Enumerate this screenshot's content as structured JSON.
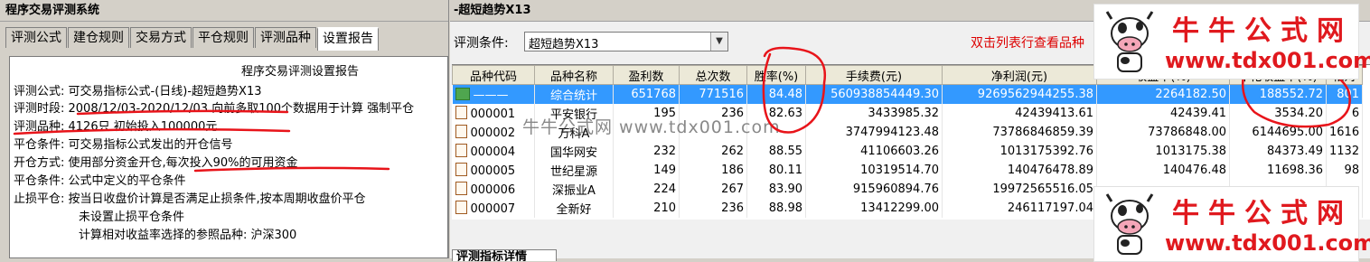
{
  "left_panel": {
    "title": "程序交易评测系统",
    "tabs": [
      "评测公式",
      "建仓规则",
      "交易方式",
      "平仓规则",
      "评测品种",
      "设置报告"
    ],
    "active_tab": "设置报告",
    "report": {
      "title": "程序交易评测设置报告",
      "lines": [
        "评测公式: 可交易指标公式-(日线)-超短趋势X13",
        "评测时段: 2008/12/03-2020/12/03 向前多取100个数据用于计算 强制平仓",
        "评测品种: 4126只 初始投入100000元",
        "平仓条件: 可交易指标公式发出的开仓信号",
        "开仓方式: 使用部分资金开仓,每次投入90%的可用资金",
        "平仓条件: 公式中定义的平仓条件",
        "止损平仓: 按当日收盘价计算是否满足止损条件,按本周期收盘价平仓",
        "未设置止损平仓条件",
        "计算相对收益率选择的参照品种: 沪深300"
      ]
    }
  },
  "right_panel": {
    "title": "-超短趋势X13",
    "condition_label": "评测条件:",
    "condition_value": "超短趋势X13",
    "hint": "双击列表行查看品种",
    "columns": [
      "品种代码",
      "品种名称",
      "盈利数",
      "总次数",
      "胜率(%)",
      "手续费(元)",
      "净利润(元)",
      "收益率(%)",
      "年化收益率(%)",
      "相对"
    ],
    "rows": [
      {
        "code": "———",
        "name": "综合统计",
        "wins": "651768",
        "total": "771516",
        "rate": "84.48",
        "fee": "560938854449.30",
        "profit": "9269562944255.38",
        "ret": "2264182.50",
        "annual": "188552.72",
        "rel": "801",
        "selected": true
      },
      {
        "code": "000001",
        "name": "平安银行",
        "wins": "195",
        "total": "236",
        "rate": "82.63",
        "fee": "3433985.32",
        "profit": "42439413.61",
        "ret": "42439.41",
        "annual": "3534.20",
        "rel": "6"
      },
      {
        "code": "000002",
        "name": "万科A",
        "wins": "",
        "total": "",
        "rate": "",
        "fee": "3747994123.48",
        "profit": "73786846859.39",
        "ret": "73786848.00",
        "annual": "6144695.00",
        "rel": "1616"
      },
      {
        "code": "000004",
        "name": "国华网安",
        "wins": "232",
        "total": "262",
        "rate": "88.55",
        "fee": "41106603.26",
        "profit": "1013175392.76",
        "ret": "1013175.38",
        "annual": "84373.49",
        "rel": "1132"
      },
      {
        "code": "000005",
        "name": "世纪星源",
        "wins": "149",
        "total": "186",
        "rate": "80.11",
        "fee": "10319514.70",
        "profit": "140476478.89",
        "ret": "140476.48",
        "annual": "11698.36",
        "rel": "98"
      },
      {
        "code": "000006",
        "name": "深振业A",
        "wins": "224",
        "total": "267",
        "rate": "83.90",
        "fee": "915960894.76",
        "profit": "19972565516.05",
        "ret": "",
        "annual": "",
        "rel": ""
      },
      {
        "code": "000007",
        "name": "全新好",
        "wins": "210",
        "total": "236",
        "rate": "88.98",
        "fee": "13412299.00",
        "profit": "246117197.04",
        "ret": "",
        "annual": "",
        "rel": ""
      }
    ],
    "bottom_tab": "评测指标详情"
  },
  "watermarks": {
    "brand": "牛牛公式网",
    "url": "www.tdx001.com",
    "overlay": "牛牛公式网 www.tdx001.com"
  },
  "colors": {
    "selection": "#3399ff",
    "brand_red": "#e0191e",
    "annotation_red": "#e8141a",
    "hint_red": "#dd0000"
  }
}
